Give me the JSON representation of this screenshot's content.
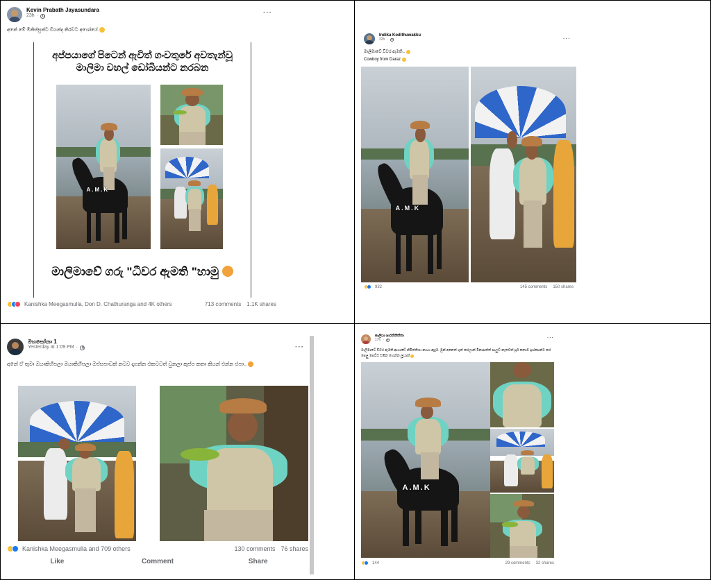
{
  "posts": [
    {
      "author": "Kevin Prabath Jayasundara",
      "time": "23h",
      "caption": "අනේ මේ මිනිස්සුන්ට වියන්ද තිරවට අශෝයේ",
      "image_headline_1": "අප්පයාගේ පිටෙන් ඇවිත් ගංවතුරේ අවතැන්වූ",
      "image_headline_2": "මාලිමා වහල් ඩෝබියන්ට නරබන",
      "image_footer_text": "මාලිමාවේ ගරු \"ධීවර ඇමති \"හාමු",
      "watermark": "A.M.K",
      "reactions_text": "Kanishka Meegasmulla, Don D. Chathuranga and 4K others",
      "comments": "713 comments",
      "shares": "1.1K shares"
    },
    {
      "author": "Indika Kodithuwakku",
      "time": "22h",
      "caption_line1": "මාලිමාවේ විවර ඇමති..",
      "caption_line2": "Cowboy from Daraz",
      "watermark": "A.M.K",
      "reactions_text": "932",
      "comments": "145 comments",
      "shares": "150 shares"
    },
    {
      "author": "මහසෝනා 1",
      "time": "Yesterday at 1:09 PM",
      "caption": "අනේ ඒ තුමා ඔයාකිහිපලා ඔයාකිහිපලා ඔප්සපාඩක් නටව දාගන්න එකටවත් වුනලා කුප්ප කතා කියන් එන්න එපා..",
      "reactions_text": "Kanishka Meegasmulla and 709 others",
      "comments": "130 comments",
      "shares": "76 shares",
      "actions": [
        "Like",
        "Comment",
        "Share"
      ]
    },
    {
      "author": "සාලියා ශාරන්නිත්තා",
      "time": "17h",
      "caption": "මාලිමාවේ විවර ඇමති ආශාඩේ නිමිත්තියා නාහා ඇදුම. මුන් අනෙත් ගුත් කරලාක් මිනාසත්ත් පාලුව් නැතවත් පූර් කතාව ඉස්සෙන්ට කර පෙලු පෙට්ට ඩමින හෙන්න ලූයාක් ",
      "watermark": "A.M.K",
      "reactions_text": "144",
      "comments": "29 comments",
      "shares": "32 shares"
    }
  ],
  "icons": {
    "more": "more-options-icon",
    "globe": "globe-icon",
    "like": "like-reaction-icon",
    "haha": "haha-reaction-icon",
    "love": "love-reaction-icon"
  }
}
